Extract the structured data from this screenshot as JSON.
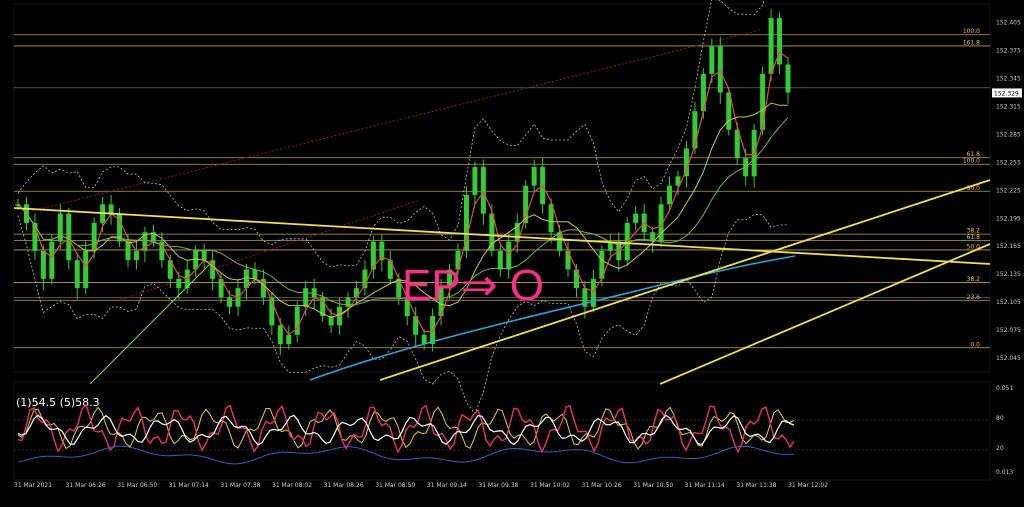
{
  "chart_data": {
    "type": "line",
    "symbol_note": "",
    "y_axis_labels": [
      "152.405",
      "152.375",
      "152.345",
      "152.315",
      "152.285",
      "152.255",
      "152.225",
      "152.195",
      "152.165",
      "152.135",
      "152.105",
      "152.075",
      "152.045"
    ],
    "ylim": [
      152.03,
      152.425
    ],
    "x_labels": [
      "31 Mar 2021",
      "31 Mar 06:26",
      "31 Mar 06:50",
      "31 Mar 07:14",
      "31 Mar 07:38",
      "31 Mar 08:02",
      "31 Mar 08:26",
      "31 Mar 08:50",
      "31 Mar 09:14",
      "31 Mar 09:38",
      "31 Mar 10:02",
      "31 Mar 10:26",
      "31 Mar 10:50",
      "31 Mar 11:14",
      "31 Mar 11:38",
      "31 Mar 12:02"
    ],
    "current_price": "152.329",
    "fib_levels": [
      {
        "label": "100.0",
        "value": 152.392
      },
      {
        "label": "161.8",
        "value": 152.38
      },
      {
        "label": "61.8",
        "value": 152.26
      },
      {
        "label": "100.0",
        "value": 152.253
      },
      {
        "label": "50.0",
        "value": 152.224
      },
      {
        "label": "38.2",
        "value": 152.178
      },
      {
        "label": "61.8",
        "value": 152.171
      },
      {
        "label": "50.0",
        "value": 152.161
      },
      {
        "label": "38.2",
        "value": 152.126
      },
      {
        "label": "23.6",
        "value": 152.107
      },
      {
        "label": "0.0",
        "value": 152.056
      }
    ],
    "price_series": [
      152.21,
      152.19,
      152.16,
      152.13,
      152.17,
      152.2,
      152.15,
      152.12,
      152.16,
      152.19,
      152.21,
      152.2,
      152.17,
      152.15,
      152.16,
      152.18,
      152.17,
      152.15,
      152.13,
      152.12,
      152.14,
      152.16,
      152.15,
      152.13,
      152.11,
      152.1,
      152.12,
      152.14,
      152.13,
      152.11,
      152.08,
      152.06,
      152.07,
      152.1,
      152.12,
      152.11,
      152.09,
      152.08,
      152.1,
      152.11,
      152.12,
      152.14,
      152.17,
      152.15,
      152.13,
      152.11,
      152.09,
      152.07,
      152.06,
      152.09,
      152.12,
      152.14,
      152.16,
      152.22,
      152.25,
      152.2,
      152.16,
      152.14,
      152.17,
      152.19,
      152.23,
      152.25,
      152.21,
      152.18,
      152.16,
      152.14,
      152.12,
      152.1,
      152.13,
      152.16,
      152.17,
      152.15,
      152.19,
      152.2,
      152.18,
      152.17,
      152.21,
      152.23,
      152.24,
      152.27,
      152.31,
      152.35,
      152.38,
      152.33,
      152.29,
      152.26,
      152.24,
      152.29,
      152.35,
      152.41,
      152.36,
      152.33
    ],
    "osc_labels": "(1)54.5 (5)58.3",
    "osc_axis_labels": [
      "0.051",
      "80",
      "20",
      "0.013"
    ],
    "annotation_text": "EP⇒ O",
    "colors": {
      "background": "#000000",
      "candle": "#33cc33",
      "fib": "#e0c040",
      "trendline": "#f0e050",
      "ma_fast": "#e0502a",
      "ma_mid": "#c8c840",
      "ma_slow": "#7ab040",
      "ma_long": "#29a3d9",
      "bands": "#bdbdbd",
      "channel": "#8a1f1f",
      "osc_fast": "#e83070",
      "osc_white": "#ffffff",
      "osc_yellow": "#e8d020",
      "osc_blue": "#3060c0",
      "annotation": "#ff2d8a"
    }
  }
}
